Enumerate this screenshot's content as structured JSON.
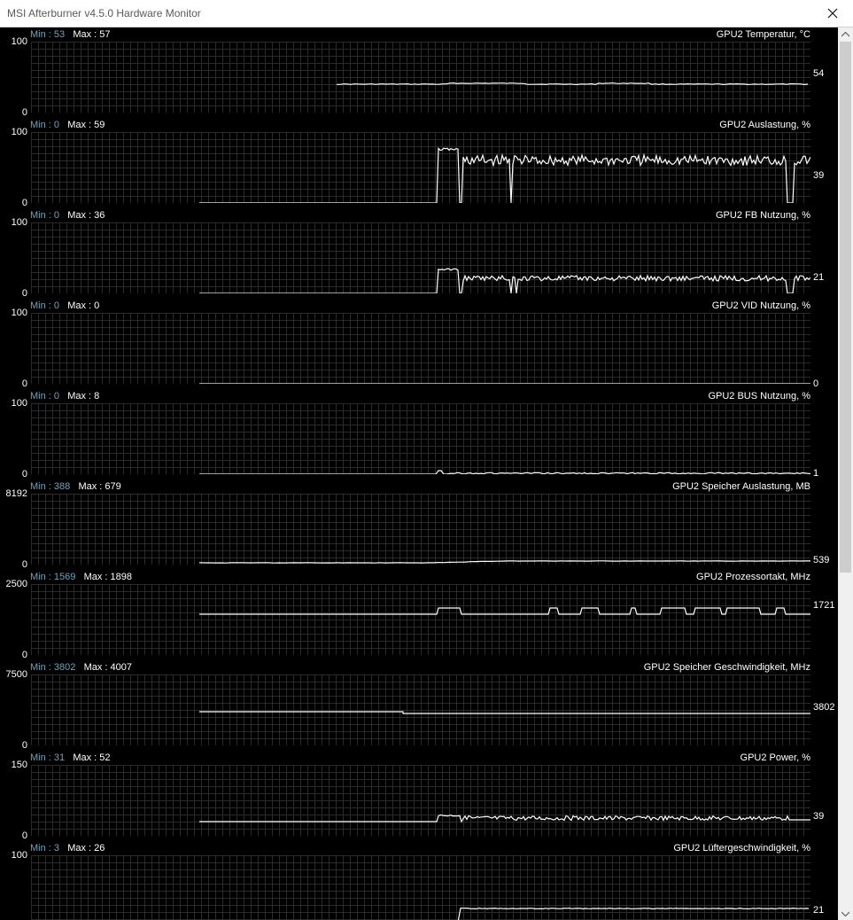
{
  "window": {
    "title": "MSI Afterburner v4.5.0 Hardware Monitor",
    "close_icon": "close-icon"
  },
  "graphs": [
    {
      "title": "GPU2 Temperatur, °C",
      "min_label": "Min",
      "min": "53",
      "max_label": "Max",
      "max": "57",
      "axis_max": "100",
      "axis_min": "0",
      "current": "54"
    },
    {
      "title": "GPU2 Auslastung, %",
      "min_label": "Min",
      "min": "0",
      "max_label": "Max",
      "max": "59",
      "axis_max": "100",
      "axis_min": "0",
      "current": "39"
    },
    {
      "title": "GPU2 FB Nutzung, %",
      "min_label": "Min",
      "min": "0",
      "max_label": "Max",
      "max": "36",
      "axis_max": "100",
      "axis_min": "0",
      "current": "21"
    },
    {
      "title": "GPU2 VID Nutzung, %",
      "min_label": "Min",
      "min": "0",
      "max_label": "Max",
      "max": "0",
      "axis_max": "100",
      "axis_min": "0",
      "current": "0"
    },
    {
      "title": "GPU2 BUS Nutzung, %",
      "min_label": "Min",
      "min": "0",
      "max_label": "Max",
      "max": "8",
      "axis_max": "100",
      "axis_min": "0",
      "current": "1"
    },
    {
      "title": "GPU2 Speicher Auslastung, MB",
      "min_label": "Min",
      "min": "388",
      "max_label": "Max",
      "max": "679",
      "axis_max": "8192",
      "axis_min": "0",
      "current": "539"
    },
    {
      "title": "GPU2 Prozessortakt, MHz",
      "min_label": "Min",
      "min": "1569",
      "max_label": "Max",
      "max": "1898",
      "axis_max": "2500",
      "axis_min": "0",
      "current": "1721"
    },
    {
      "title": "GPU2 Speicher Geschwindigkeit, MHz",
      "min_label": "Min",
      "min": "3802",
      "max_label": "Max",
      "max": "4007",
      "axis_max": "7500",
      "axis_min": "0",
      "current": "3802"
    },
    {
      "title": "GPU2 Power, %",
      "min_label": "Min",
      "min": "31",
      "max_label": "Max",
      "max": "52",
      "axis_max": "150",
      "axis_min": "0",
      "current": "39"
    },
    {
      "title": "GPU2 Lüftergeschwindigkeit, %",
      "min_label": "Min",
      "min": "3",
      "max_label": "Max",
      "max": "26",
      "axis_max": "100",
      "axis_min": "0",
      "current": "21"
    }
  ],
  "colors": {
    "background": "#000000",
    "grid": "#2b2b2b",
    "line": "#ffffff",
    "min_label": "#6fa3b9"
  }
}
